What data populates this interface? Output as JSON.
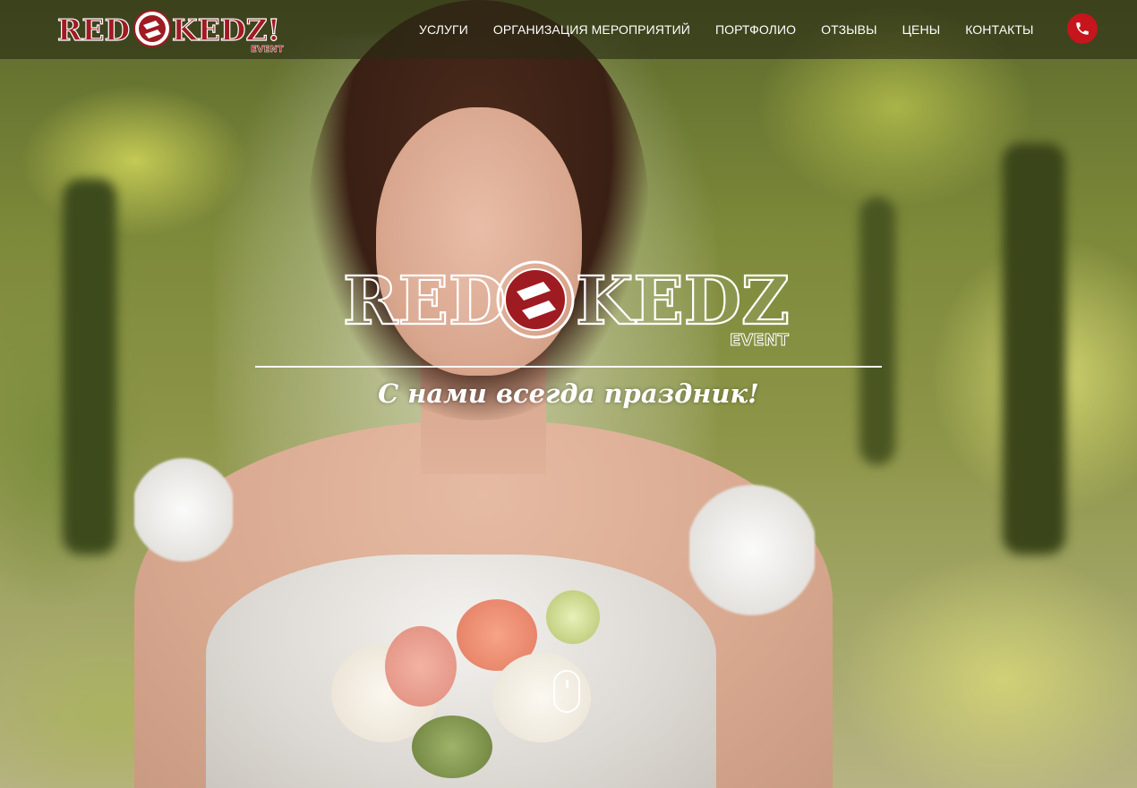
{
  "header": {
    "logo_text": "RED KEDZ!",
    "logo_subtext": "EVENT",
    "logo_badge_text": "RED KEDZ"
  },
  "nav": {
    "items": [
      {
        "label": "УСЛУГИ"
      },
      {
        "label": "ОРГАНИЗАЦИЯ МЕРОПРИЯТИЙ"
      },
      {
        "label": "ПОРТФОЛИО"
      },
      {
        "label": "ОТЗЫВЫ"
      },
      {
        "label": "ЦЕНЫ"
      },
      {
        "label": "КОНТАКТЫ"
      }
    ],
    "phone_icon": "phone-icon"
  },
  "hero": {
    "logo_text": "RED KEDZ!",
    "logo_subtext": "EVENT",
    "tagline": "С нами всегда праздник!",
    "scroll_icon": "mouse-scroll-icon"
  },
  "colors": {
    "brand_red": "#9e1b22",
    "accent_red": "#c4161c",
    "header_bg": "rgba(40,42,20,.62)"
  }
}
